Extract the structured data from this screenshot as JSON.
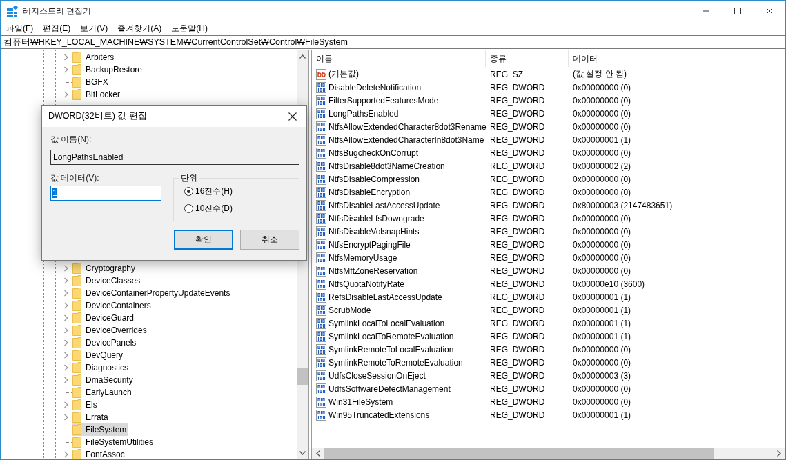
{
  "window": {
    "title": "레지스트리 편집기"
  },
  "menu": [
    "파일(F)",
    "편집(E)",
    "보기(V)",
    "즐겨찾기(A)",
    "도움말(H)"
  ],
  "address": "컴퓨터₩HKEY_LOCAL_MACHINE₩SYSTEM₩CurrentControlSet₩Control₩FileSystem",
  "tree": {
    "items": [
      {
        "label": "Arbiters",
        "has_children": true,
        "selected": false
      },
      {
        "label": "BackupRestore",
        "has_children": true,
        "selected": false
      },
      {
        "label": "BGFX",
        "has_children": false,
        "selected": false
      },
      {
        "label": "BitLocker",
        "has_children": true,
        "selected": false
      },
      {
        "kind": "hidden"
      },
      {
        "label": "Cryptography",
        "has_children": true,
        "selected": false
      },
      {
        "label": "DeviceClasses",
        "has_children": true,
        "selected": false
      },
      {
        "label": "DeviceContainerPropertyUpdateEvents",
        "has_children": true,
        "selected": false
      },
      {
        "label": "DeviceContainers",
        "has_children": true,
        "selected": false
      },
      {
        "label": "DeviceGuard",
        "has_children": true,
        "selected": false
      },
      {
        "label": "DeviceOverrides",
        "has_children": true,
        "selected": false
      },
      {
        "label": "DevicePanels",
        "has_children": true,
        "selected": false
      },
      {
        "label": "DevQuery",
        "has_children": true,
        "selected": false
      },
      {
        "label": "Diagnostics",
        "has_children": true,
        "selected": false
      },
      {
        "label": "DmaSecurity",
        "has_children": true,
        "selected": false
      },
      {
        "label": "EarlyLaunch",
        "has_children": false,
        "selected": false
      },
      {
        "label": "Els",
        "has_children": true,
        "selected": false
      },
      {
        "label": "Errata",
        "has_children": true,
        "selected": false
      },
      {
        "label": "FileSystem",
        "has_children": false,
        "selected": true
      },
      {
        "label": "FileSystemUtilities",
        "has_children": false,
        "selected": false
      },
      {
        "label": "FontAssoc",
        "has_children": true,
        "selected": false
      }
    ]
  },
  "values": {
    "columns": [
      "이름",
      "종류",
      "데이터"
    ],
    "rows": [
      {
        "kind": "string",
        "name": "(기본값)",
        "type": "REG_SZ",
        "data": "(값 설정 안 됨)"
      },
      {
        "kind": "dword",
        "name": "DisableDeleteNotification",
        "type": "REG_DWORD",
        "data": "0x00000000 (0)"
      },
      {
        "kind": "dword",
        "name": "FilterSupportedFeaturesMode",
        "type": "REG_DWORD",
        "data": "0x00000000 (0)"
      },
      {
        "kind": "dword",
        "name": "LongPathsEnabled",
        "type": "REG_DWORD",
        "data": "0x00000000 (0)"
      },
      {
        "kind": "dword",
        "name": "NtfsAllowExtendedCharacter8dot3Rename",
        "type": "REG_DWORD",
        "data": "0x00000000 (0)"
      },
      {
        "kind": "dword",
        "name": "NtfsAllowExtendedCharacterIn8dot3Name",
        "type": "REG_DWORD",
        "data": "0x00000001 (1)"
      },
      {
        "kind": "dword",
        "name": "NtfsBugcheckOnCorrupt",
        "type": "REG_DWORD",
        "data": "0x00000000 (0)"
      },
      {
        "kind": "dword",
        "name": "NtfsDisable8dot3NameCreation",
        "type": "REG_DWORD",
        "data": "0x00000002 (2)"
      },
      {
        "kind": "dword",
        "name": "NtfsDisableCompression",
        "type": "REG_DWORD",
        "data": "0x00000000 (0)"
      },
      {
        "kind": "dword",
        "name": "NtfsDisableEncryption",
        "type": "REG_DWORD",
        "data": "0x00000000 (0)"
      },
      {
        "kind": "dword",
        "name": "NtfsDisableLastAccessUpdate",
        "type": "REG_DWORD",
        "data": "0x80000003 (2147483651)"
      },
      {
        "kind": "dword",
        "name": "NtfsDisableLfsDowngrade",
        "type": "REG_DWORD",
        "data": "0x00000000 (0)"
      },
      {
        "kind": "dword",
        "name": "NtfsDisableVolsnapHints",
        "type": "REG_DWORD",
        "data": "0x00000000 (0)"
      },
      {
        "kind": "dword",
        "name": "NtfsEncryptPagingFile",
        "type": "REG_DWORD",
        "data": "0x00000000 (0)"
      },
      {
        "kind": "dword",
        "name": "NtfsMemoryUsage",
        "type": "REG_DWORD",
        "data": "0x00000000 (0)"
      },
      {
        "kind": "dword",
        "name": "NtfsMftZoneReservation",
        "type": "REG_DWORD",
        "data": "0x00000000 (0)"
      },
      {
        "kind": "dword",
        "name": "NtfsQuotaNotifyRate",
        "type": "REG_DWORD",
        "data": "0x00000e10 (3600)"
      },
      {
        "kind": "dword",
        "name": "RefsDisableLastAccessUpdate",
        "type": "REG_DWORD",
        "data": "0x00000001 (1)"
      },
      {
        "kind": "dword",
        "name": "ScrubMode",
        "type": "REG_DWORD",
        "data": "0x00000001 (1)"
      },
      {
        "kind": "dword",
        "name": "SymlinkLocalToLocalEvaluation",
        "type": "REG_DWORD",
        "data": "0x00000001 (1)"
      },
      {
        "kind": "dword",
        "name": "SymlinkLocalToRemoteEvaluation",
        "type": "REG_DWORD",
        "data": "0x00000001 (1)"
      },
      {
        "kind": "dword",
        "name": "SymlinkRemoteToLocalEvaluation",
        "type": "REG_DWORD",
        "data": "0x00000000 (0)"
      },
      {
        "kind": "dword",
        "name": "SymlinkRemoteToRemoteEvaluation",
        "type": "REG_DWORD",
        "data": "0x00000000 (0)"
      },
      {
        "kind": "dword",
        "name": "UdfsCloseSessionOnEject",
        "type": "REG_DWORD",
        "data": "0x00000003 (3)"
      },
      {
        "kind": "dword",
        "name": "UdfsSoftwareDefectManagement",
        "type": "REG_DWORD",
        "data": "0x00000000 (0)"
      },
      {
        "kind": "dword",
        "name": "Win31FileSystem",
        "type": "REG_DWORD",
        "data": "0x00000000 (0)"
      },
      {
        "kind": "dword",
        "name": "Win95TruncatedExtensions",
        "type": "REG_DWORD",
        "data": "0x00000001 (1)"
      }
    ]
  },
  "dialog": {
    "title": "DWORD(32비트) 값 편집",
    "name_label": "값 이름(N):",
    "name_value": "LongPathsEnabled",
    "data_label": "값 데이터(V):",
    "data_value": "1",
    "base_label": "단위",
    "radios": [
      {
        "label": "16진수(H)",
        "selected": true
      },
      {
        "label": "10진수(D)",
        "selected": false
      }
    ],
    "buttons": [
      {
        "label": "확인",
        "default": true
      },
      {
        "label": "취소",
        "default": false
      }
    ]
  }
}
